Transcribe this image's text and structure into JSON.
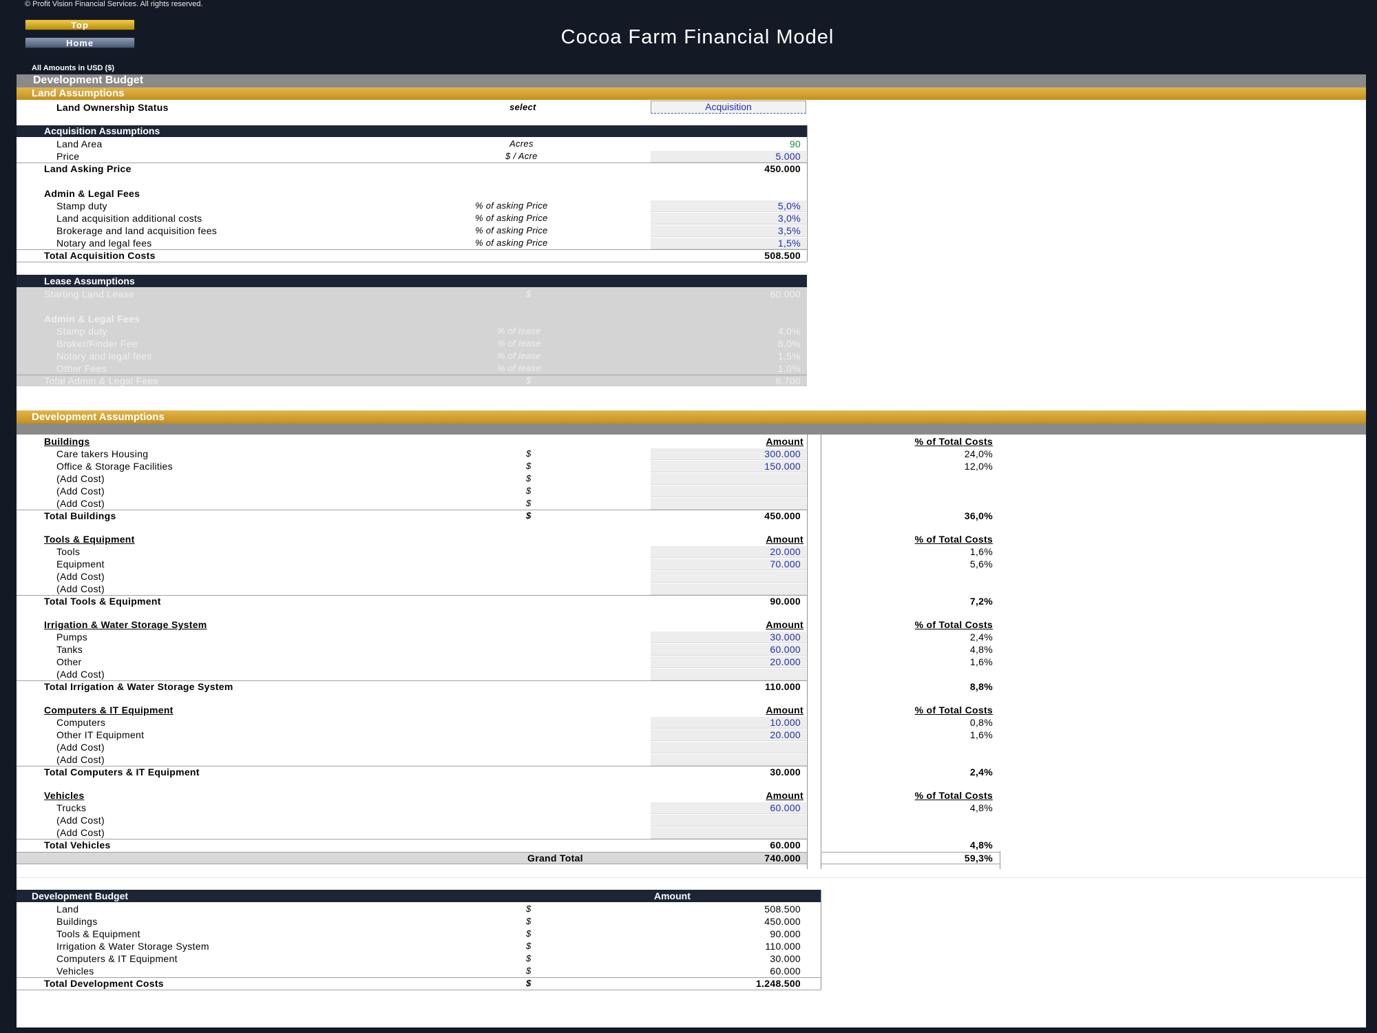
{
  "header": {
    "copyright": "© Profit Vision Financial Services. All rights reserved.",
    "top_button": "Top",
    "home_button": "Home",
    "title": "Cocoa Farm Financial Model",
    "amounts_in": "All Amounts in  USD ($)"
  },
  "dev_budget_band": "Development Budget",
  "land": {
    "band": "Land Assumptions",
    "ownership_label": "Land Ownership Status",
    "ownership_hint": "select",
    "ownership_value": "Acquisition"
  },
  "acq": {
    "header": "Acquisition Assumptions",
    "area_label": "Land Area",
    "area_unit": "Acres",
    "area_value": "90",
    "price_label": "Price",
    "price_unit": "$ / Acre",
    "price_value": "5.000",
    "asking_label": "Land Asking Price",
    "asking_value": "450.000",
    "fees_title": "Admin & Legal Fees",
    "fees": [
      {
        "label": "Stamp duty",
        "unit": "% of asking Price",
        "value": "5,0%"
      },
      {
        "label": "Land acquisition additional costs",
        "unit": "% of asking Price",
        "value": "3,0%"
      },
      {
        "label": "Brokerage and land acquisition fees",
        "unit": "% of asking Price",
        "value": "3,5%"
      },
      {
        "label": "Notary and legal fees",
        "unit": "% of asking Price",
        "value": "1,5%"
      }
    ],
    "total_label": "Total Acquisition Costs",
    "total_value": "508.500"
  },
  "lease": {
    "header": "Lease Assumptions",
    "start_label": "Starting Land Lease",
    "start_unit": "$",
    "start_value": "60.000",
    "fees_title": "Admin & Legal Fees",
    "fees": [
      {
        "label": "Stamp duty",
        "unit": "% of lease",
        "value": "4,0%"
      },
      {
        "label": "Broker/Finder Fee",
        "unit": "% of lease",
        "value": "8,0%"
      },
      {
        "label": "Notary and legal fees",
        "unit": "% of lease",
        "value": "1,5%"
      },
      {
        "label": "Other Fees",
        "unit": "% of lease",
        "value": "1,0%"
      }
    ],
    "total_label": "Total Admin & Legal Fees",
    "total_unit": "$",
    "total_value": "8.700"
  },
  "dev": {
    "band": "Development Assumptions",
    "amount_hdr": "Amount",
    "pct_hdr": "% of Total Costs",
    "groups": [
      {
        "title": "Buildings",
        "items": [
          {
            "label": "Care takers Housing",
            "cur": "$",
            "value": "300.000",
            "pct": "24,0%"
          },
          {
            "label": "Office & Storage Facilities",
            "cur": "$",
            "value": "150.000",
            "pct": "12,0%"
          },
          {
            "label": "(Add Cost)",
            "cur": "$",
            "value": "",
            "pct": ""
          },
          {
            "label": "(Add Cost)",
            "cur": "$",
            "value": "",
            "pct": ""
          },
          {
            "label": "(Add Cost)",
            "cur": "$",
            "value": "",
            "pct": ""
          }
        ],
        "total_label": "Total Buildings",
        "total_cur": "$",
        "total_value": "450.000",
        "total_pct": "36,0%"
      },
      {
        "title": "Tools & Equipment",
        "items": [
          {
            "label": "Tools",
            "cur": "",
            "value": "20.000",
            "pct": "1,6%"
          },
          {
            "label": "Equipment",
            "cur": "",
            "value": "70.000",
            "pct": "5,6%"
          },
          {
            "label": "(Add Cost)",
            "cur": "",
            "value": "",
            "pct": ""
          },
          {
            "label": "(Add Cost)",
            "cur": "",
            "value": "",
            "pct": ""
          }
        ],
        "total_label": "Total Tools & Equipment",
        "total_cur": "",
        "total_value": "90.000",
        "total_pct": "7,2%"
      },
      {
        "title": "Irrigation & Water Storage System",
        "items": [
          {
            "label": "Pumps",
            "cur": "",
            "value": "30.000",
            "pct": "2,4%"
          },
          {
            "label": "Tanks",
            "cur": "",
            "value": "60.000",
            "pct": "4,8%"
          },
          {
            "label": "Other",
            "cur": "",
            "value": "20.000",
            "pct": "1,6%"
          },
          {
            "label": "(Add Cost)",
            "cur": "",
            "value": "",
            "pct": ""
          }
        ],
        "total_label": "Total Irrigation & Water Storage System",
        "total_cur": "",
        "total_value": "110.000",
        "total_pct": "8,8%"
      },
      {
        "title": "Computers & IT Equipment",
        "items": [
          {
            "label": "Computers",
            "cur": "",
            "value": "10.000",
            "pct": "0,8%"
          },
          {
            "label": "Other IT Equipment",
            "cur": "",
            "value": "20.000",
            "pct": "1,6%"
          },
          {
            "label": "(Add Cost)",
            "cur": "",
            "value": "",
            "pct": ""
          },
          {
            "label": "(Add Cost)",
            "cur": "",
            "value": "",
            "pct": ""
          }
        ],
        "total_label": "Total Computers & IT Equipment",
        "total_cur": "",
        "total_value": "30.000",
        "total_pct": "2,4%"
      },
      {
        "title": "Vehicles",
        "items": [
          {
            "label": "Trucks",
            "cur": "",
            "value": "60.000",
            "pct": "4,8%"
          },
          {
            "label": "(Add Cost)",
            "cur": "",
            "value": "",
            "pct": ""
          },
          {
            "label": "(Add Cost)",
            "cur": "",
            "value": "",
            "pct": ""
          }
        ],
        "total_label": "Total Vehicles",
        "total_cur": "",
        "total_value": "60.000",
        "total_pct": "4,8%"
      }
    ],
    "grand_label": "Grand Total",
    "grand_value": "740.000",
    "grand_pct": "59,3%"
  },
  "summary": {
    "header": "Development Budget",
    "amount_hdr": "Amount",
    "rows": [
      {
        "label": "Land",
        "cur": "$",
        "value": "508.500"
      },
      {
        "label": "Buildings",
        "cur": "$",
        "value": "450.000"
      },
      {
        "label": "Tools & Equipment",
        "cur": "$",
        "value": "90.000"
      },
      {
        "label": "Irrigation & Water Storage System",
        "cur": "$",
        "value": "110.000"
      },
      {
        "label": "Computers & IT Equipment",
        "cur": "$",
        "value": "30.000"
      },
      {
        "label": "Vehicles",
        "cur": "$",
        "value": "60.000"
      }
    ],
    "total_label": "Total Development Costs",
    "total_cur": "$",
    "total_value": "1.248.500"
  }
}
